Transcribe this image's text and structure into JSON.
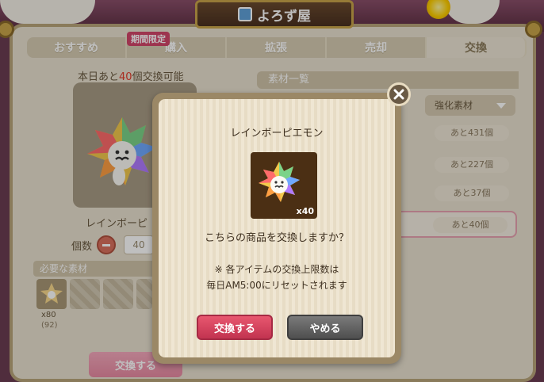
{
  "header": {
    "title": "よろず屋"
  },
  "tabs": [
    {
      "label": "おすすめ"
    },
    {
      "label": "購入"
    },
    {
      "label": "拡張"
    },
    {
      "label": "売却"
    },
    {
      "label": "交換"
    }
  ],
  "tab_badge": "期間限定",
  "left": {
    "limit_prefix": "本日あと",
    "limit_num": "40",
    "limit_suffix": "個交換可能",
    "item_name": "レインボーピ",
    "qty_label": "個数",
    "qty_value": "40",
    "req_header": "必要な素材",
    "req_qty": "x80",
    "req_owned": "(92)",
    "exchange_label": "交換する"
  },
  "right": {
    "header": "素材一覧",
    "filter": "強化素材",
    "rows": [
      {
        "remaining": "あと431個"
      },
      {
        "remaining": "あと227個"
      },
      {
        "remaining": "あと37個"
      },
      {
        "remaining": "あと40個"
      }
    ]
  },
  "modal": {
    "title": "レインボーピエモン",
    "item_count": "x40",
    "question": "こちらの商品を交換しますか？",
    "note_line1": "※ 各アイテムの交換上限数は",
    "note_line2": "毎日AM5:00にリセットされます",
    "ok_label": "交換する",
    "cancel_label": "やめる"
  }
}
